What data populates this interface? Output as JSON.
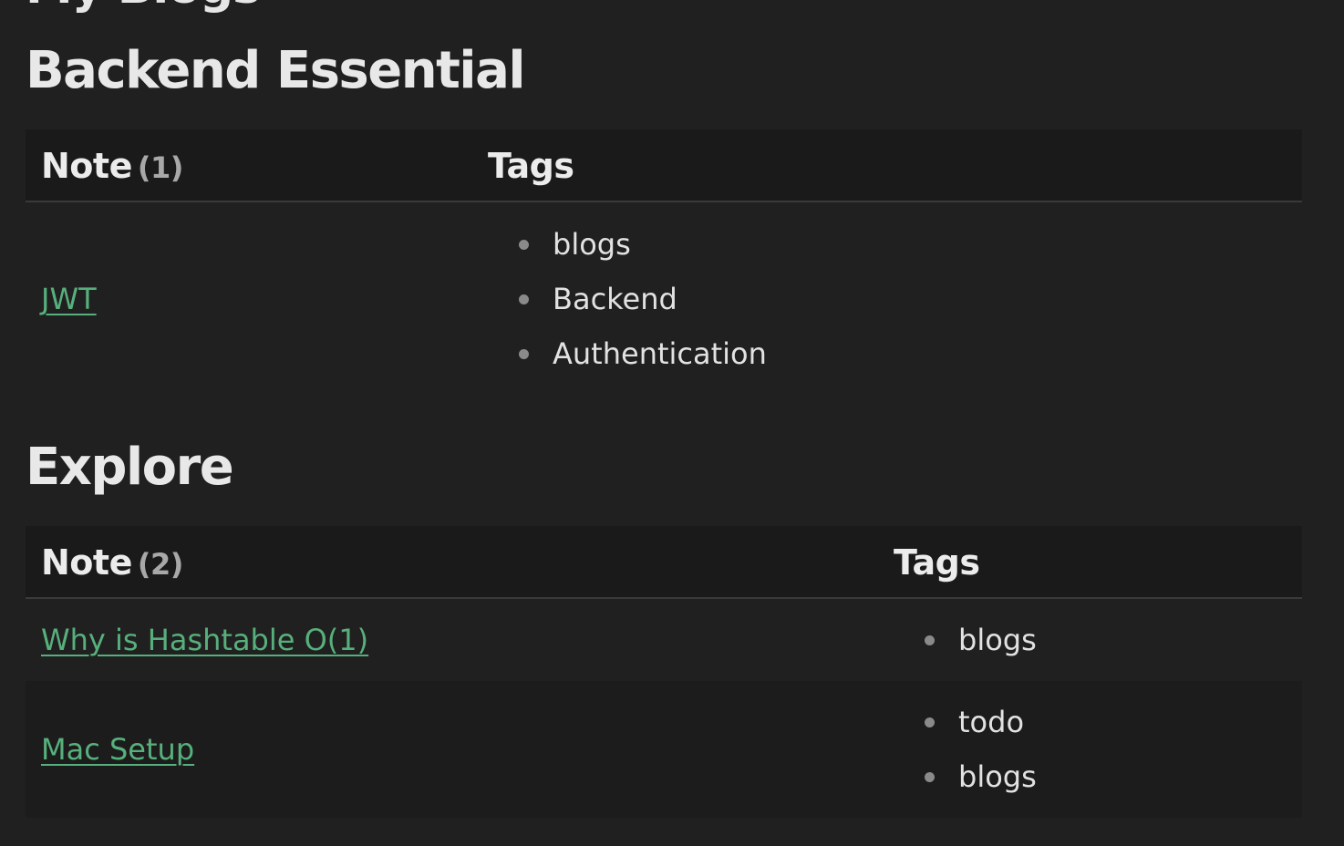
{
  "page": {
    "partial_heading": "My Blogs"
  },
  "sections": [
    {
      "title": "Backend Essential",
      "header": {
        "note_label": "Note",
        "note_count": "(1)",
        "tags_label": "Tags"
      },
      "rows": [
        {
          "note": "JWT",
          "tags": [
            "blogs",
            "Backend",
            "Authentication"
          ]
        }
      ]
    },
    {
      "title": "Explore",
      "header": {
        "note_label": "Note",
        "note_count": "(2)",
        "tags_label": "Tags"
      },
      "rows": [
        {
          "note": "Why is Hashtable O(1)",
          "tags": [
            "blogs"
          ]
        },
        {
          "note": "Mac Setup",
          "tags": [
            "todo",
            "blogs"
          ]
        }
      ]
    }
  ],
  "colors": {
    "background": "#202020",
    "header_background": "#1a1a1a",
    "link": "#57b07c",
    "text": "#e2e2e2",
    "muted": "#a8a8a8"
  }
}
